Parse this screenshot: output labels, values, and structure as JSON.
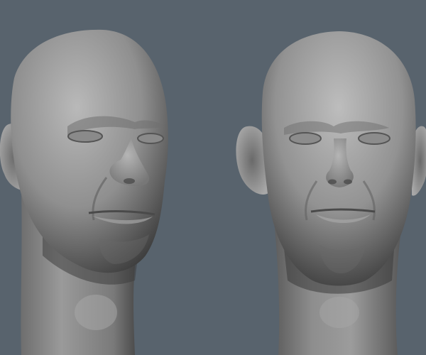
{
  "viewport": {
    "background_color": "#58636d",
    "material": "matcap-grey"
  },
  "models": [
    {
      "name": "head-sculpt-three-quarter",
      "view": "three-quarter",
      "base_color": "#8e8e8e"
    },
    {
      "name": "head-sculpt-front",
      "view": "front",
      "base_color": "#8e8e8e"
    }
  ]
}
